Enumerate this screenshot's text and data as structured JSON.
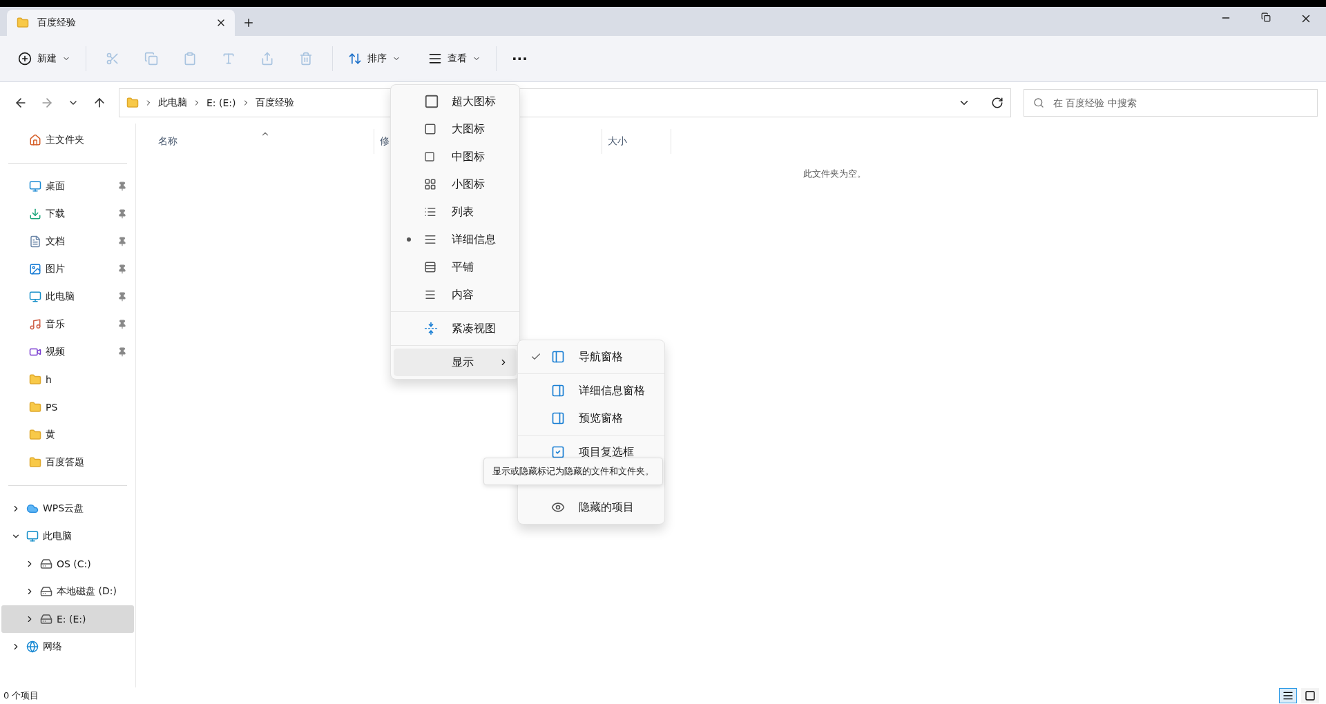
{
  "tab": {
    "title": "百度经验",
    "selected": true
  },
  "toolbar": {
    "new_label": "新建",
    "sort_label": "排序",
    "view_label": "查看",
    "more": "···"
  },
  "address": {
    "crumbs": [
      "此电脑",
      "E: (E:)",
      "百度经验"
    ]
  },
  "search": {
    "placeholder": "在 百度经验 中搜索"
  },
  "sidebar": {
    "home": "主文件夹",
    "quick": [
      {
        "label": "桌面",
        "pinned": true
      },
      {
        "label": "下载",
        "pinned": true
      },
      {
        "label": "文档",
        "pinned": true
      },
      {
        "label": "图片",
        "pinned": true
      },
      {
        "label": "此电脑",
        "pinned": true
      },
      {
        "label": "音乐",
        "pinned": true
      },
      {
        "label": "视频",
        "pinned": true
      },
      {
        "label": "h",
        "pinned": false
      },
      {
        "label": "PS",
        "pinned": false
      },
      {
        "label": "黄",
        "pinned": false
      },
      {
        "label": "百度答题",
        "pinned": false
      }
    ],
    "tree": [
      {
        "label": "WPS云盘",
        "expanded": false,
        "selected": false
      },
      {
        "label": "此电脑",
        "expanded": true,
        "selected": false,
        "children": [
          {
            "label": "OS (C:)",
            "expanded": false,
            "selected": false
          },
          {
            "label": "本地磁盘 (D:)",
            "expanded": false,
            "selected": false
          },
          {
            "label": "E: (E:)",
            "expanded": false,
            "selected": true
          }
        ]
      },
      {
        "label": "网络",
        "expanded": false,
        "selected": false
      }
    ]
  },
  "table": {
    "columns": [
      "名称",
      "修",
      "大小"
    ],
    "empty_message": "此文件夹为空。"
  },
  "view_menu": {
    "items": [
      {
        "label": "超大图标",
        "selected": false
      },
      {
        "label": "大图标",
        "selected": false
      },
      {
        "label": "中图标",
        "selected": false
      },
      {
        "label": "小图标",
        "selected": false
      },
      {
        "label": "列表",
        "selected": false
      },
      {
        "label": "详细信息",
        "selected": true
      },
      {
        "label": "平铺",
        "selected": false
      },
      {
        "label": "内容",
        "selected": false
      }
    ],
    "compact": {
      "label": "紧凑视图"
    },
    "show": {
      "label": "显示",
      "expanded": true
    }
  },
  "show_menu": {
    "items": [
      {
        "label": "导航窗格",
        "checked": true
      },
      {
        "label": "详细信息窗格",
        "checked": false
      },
      {
        "label": "预览窗格",
        "checked": false
      },
      {
        "label": "项目复选框",
        "checked": false
      },
      {
        "label": "隐藏的项目",
        "checked": false
      }
    ]
  },
  "tooltip": "显示或隐藏标记为隐藏的文件和文件夹。",
  "status_bar": {
    "count": "0 个项目",
    "view_toggles": [
      {
        "selected": true
      },
      {
        "selected": false
      }
    ]
  }
}
